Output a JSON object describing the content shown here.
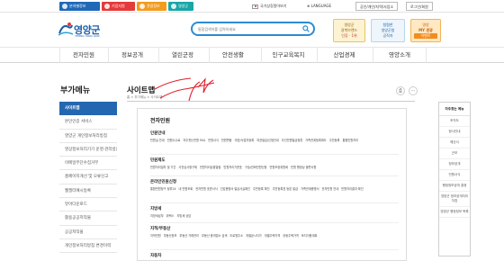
{
  "topbar": {
    "quick_tabs": [
      {
        "label": "분야별정보",
        "color": "#1f69b7"
      },
      {
        "label": "기업지원",
        "color": "#e43a3a"
      },
      {
        "label": "관광정보",
        "color": "#f29c1e"
      },
      {
        "label": "영양군청",
        "color": "#19a6a6"
      }
    ],
    "national": "국가상징알아보기",
    "language": "LANGUAGE",
    "auth_btn": "공인/개인/지역/사업소",
    "login_btn": "로그인/회원"
  },
  "header": {
    "logo_name": "영양군",
    "logo_en": "YEONG YANG GUN",
    "search_placeholder": "통합검색어를 입력하세요",
    "banner1": {
      "lines": [
        "영양군",
        "경북브랜드",
        "인증 · 1위"
      ]
    },
    "banner2": {
      "lines": [
        "청렴한",
        "영양군청",
        "공직자"
      ]
    },
    "banner3": {
      "lines": [
        "영양",
        "MY 관광",
        "이벤트"
      ]
    }
  },
  "gnb": [
    "전자민원",
    "정보공개",
    "열린군정",
    "안전생활",
    "인구교육복지",
    "산업경제",
    "영양소개"
  ],
  "lnb": {
    "title": "부가메뉴",
    "items": [
      "사이트맵",
      "본인인증 서비스",
      "영양군 개인정보처리방침",
      "영상정보처리기기 운영·관리방침",
      "이메일무단수집거부",
      "홈페이지개선 및 오류신고",
      "웹필터예시등록",
      "뷰어다운로드",
      "활용공공저작물",
      "공공저작물",
      "개인정보처리방침 변경이력"
    ]
  },
  "content": {
    "title": "사이트맵",
    "path": "홈 > 부가메뉴 > 사이트맵",
    "sections": [
      {
        "heading": "인원안내",
        "links": [
          "민원실 안내",
          "민원수수료",
          "자주찻는민원 FAQ",
          "민원서식",
          "민원편람",
          "여권/사업자등록",
          "여권발급/신청안내",
          "무인민원발급정류",
          "가족관계등록제도",
          "주민등록",
          "통합민원처리"
        ]
      },
      {
        "heading": "민원제도",
        "links": [
          "민원처리절차 및 기간",
          "사전심사청구제",
          "민원처리상황열람",
          "민원처리기준표",
          "구술/전화민원신청",
          "민원조정위원회",
          "민원 행정상 불편사항"
        ]
      },
      {
        "heading": "온라인민원신청",
        "links": [
          "통합민원창구 정부24",
          "내 민원조회",
          "전자민원 표준서식",
          "인감증명서 발급사실확인",
          "주민등록 확인",
          "주민등록표 등본 발급",
          "가족관계증명서",
          "전자민원 안내",
          "민원처리결과 확인"
        ]
      },
      {
        "heading": "지방세",
        "links": [
          "지방세납부",
          "위택스",
          "지방세 상담"
        ]
      },
      {
        "heading": "지적/부동산",
        "links": [
          "지적민원",
          "부동산정보",
          "부동산 거래관리",
          "부동산 중개업소 검색",
          "도로명주소",
          "개별공시지가",
          "개별주택가격",
          "공동주택가격",
          "토지이용계획"
        ]
      }
    ],
    "extra_heading": "자동차"
  },
  "side": {
    "title": "자주찾는 메뉴",
    "items": [
      "조직도",
      "청사안내",
      "예산서",
      "군보",
      "정보공개",
      "민원서식",
      "행정정보공개 결정",
      "영양군 정보공개처리지침",
      "영양군 행정정보 목록"
    ]
  }
}
